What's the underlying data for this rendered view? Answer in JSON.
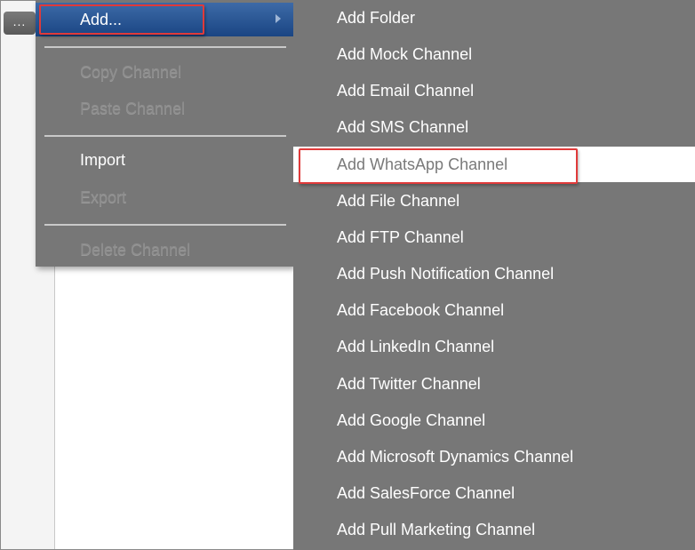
{
  "toolbar": {
    "ellipsis_label": "..."
  },
  "context_menu": {
    "items": [
      {
        "label": "Add...",
        "state": "active",
        "has_submenu": true
      },
      {
        "label": "Copy Channel",
        "state": "disabled"
      },
      {
        "label": "Paste Channel",
        "state": "disabled"
      },
      {
        "label": "Import",
        "state": "enabled"
      },
      {
        "label": "Export",
        "state": "disabled"
      },
      {
        "label": "Delete Channel",
        "state": "disabled"
      }
    ]
  },
  "submenu": {
    "items": [
      {
        "label": "Add Folder"
      },
      {
        "label": "Add Mock Channel"
      },
      {
        "label": "Add Email Channel"
      },
      {
        "label": "Add SMS Channel"
      },
      {
        "label": "Add WhatsApp Channel",
        "state": "hovered"
      },
      {
        "label": "Add File Channel"
      },
      {
        "label": "Add FTP Channel"
      },
      {
        "label": "Add Push Notification Channel"
      },
      {
        "label": "Add Facebook Channel"
      },
      {
        "label": "Add LinkedIn Channel"
      },
      {
        "label": "Add Twitter Channel"
      },
      {
        "label": "Add Google Channel"
      },
      {
        "label": "Add Microsoft Dynamics Channel"
      },
      {
        "label": "Add SalesForce Channel"
      },
      {
        "label": "Add Pull Marketing Channel"
      }
    ]
  },
  "colors": {
    "menu_bg": "#777777",
    "active_item": "#1a4583",
    "highlight_box": "#e03a3a",
    "disabled_text": "#8e8e8e",
    "hover_bg": "#ffffff"
  }
}
